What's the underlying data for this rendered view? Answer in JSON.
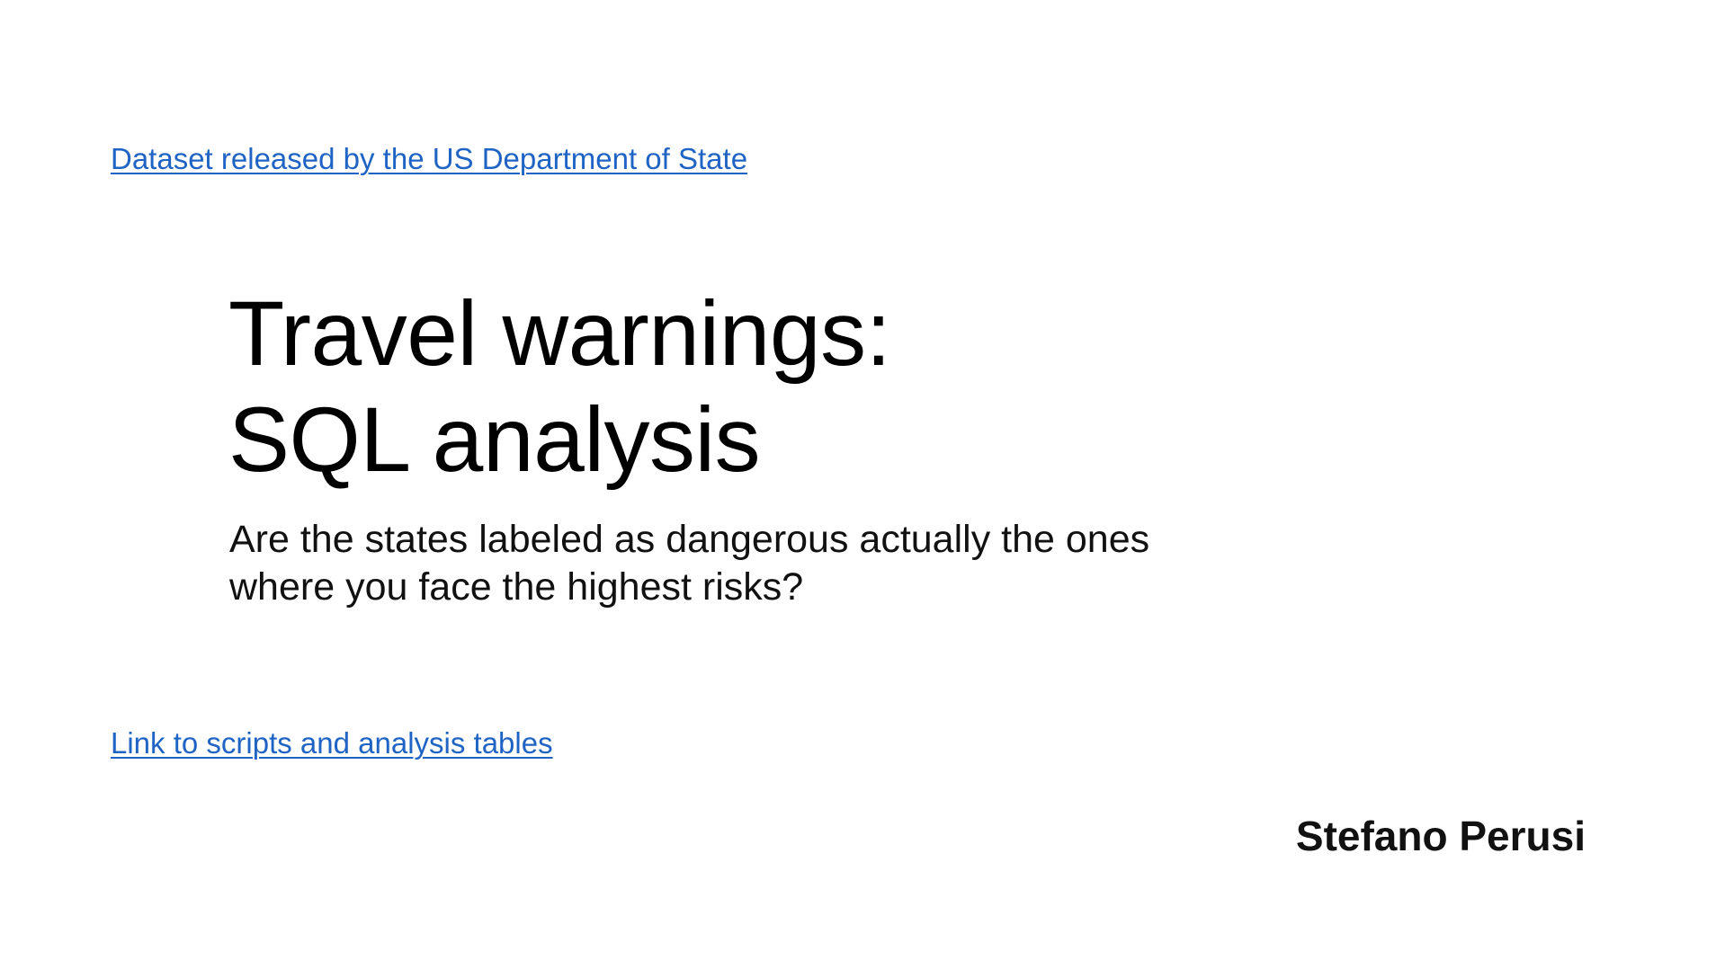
{
  "links": {
    "dataset": "Dataset released by the US Department of State",
    "scripts": "Link to scripts and analysis tables"
  },
  "title": {
    "line1": "Travel warnings:",
    "line2": "SQL analysis"
  },
  "subtitle": {
    "line1": "Are the states labeled as dangerous actually the ones",
    "line2": "where you face the highest risks?"
  },
  "author": "Stefano Perusi",
  "colors": {
    "link": "#1f64c4",
    "text": "#000000",
    "background": "#ffffff"
  }
}
